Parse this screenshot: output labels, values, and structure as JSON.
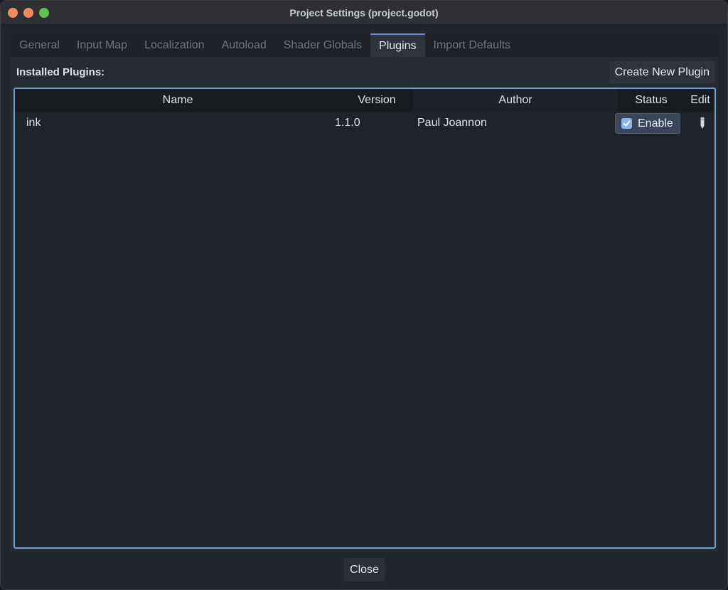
{
  "window": {
    "title": "Project Settings (project.godot)"
  },
  "tabs": [
    {
      "label": "General",
      "active": false
    },
    {
      "label": "Input Map",
      "active": false
    },
    {
      "label": "Localization",
      "active": false
    },
    {
      "label": "Autoload",
      "active": false
    },
    {
      "label": "Shader Globals",
      "active": false
    },
    {
      "label": "Plugins",
      "active": true
    },
    {
      "label": "Import Defaults",
      "active": false
    }
  ],
  "plugins": {
    "installed_label": "Installed Plugins:",
    "create_button": "Create New Plugin",
    "columns": {
      "name": "Name",
      "version": "Version",
      "author": "Author",
      "status": "Status",
      "edit": "Edit"
    },
    "rows": [
      {
        "name": "ink",
        "version": "1.1.0",
        "author": "Paul Joannon",
        "status_label": "Enable",
        "enabled": true
      }
    ]
  },
  "footer": {
    "close_button": "Close"
  },
  "icons": {
    "checkbox": "checkmark-icon",
    "edit": "pencil-icon"
  },
  "colors": {
    "accent": "#6f9ed8",
    "checkbox": "#8db4e6",
    "traffic_close": "#ef8a5e",
    "traffic_max": "#5fc152"
  }
}
